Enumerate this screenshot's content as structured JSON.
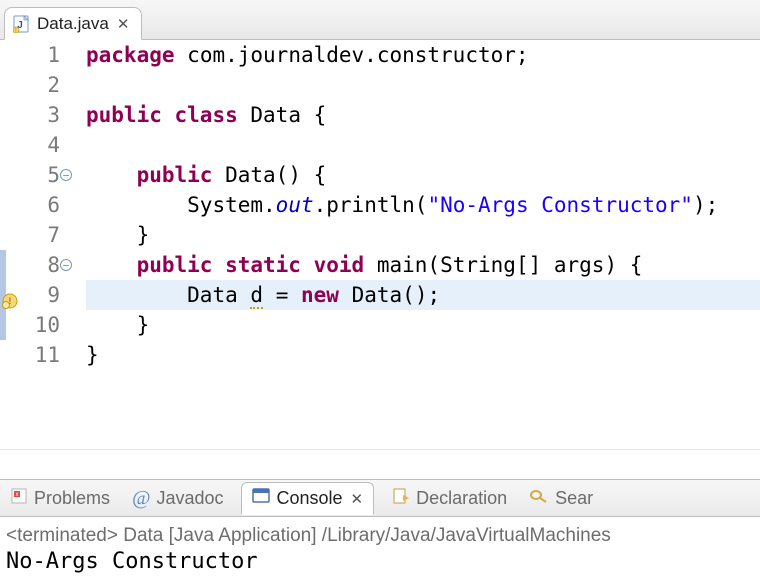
{
  "editor": {
    "tab": {
      "filename": "Data.java",
      "close_glyph": "✕"
    },
    "lines": [
      {
        "n": 1,
        "tokens": [
          [
            "kw",
            "package"
          ],
          [
            "sp",
            " "
          ],
          [
            "pkg",
            "com.journaldev.constructor"
          ],
          [
            "p",
            ";"
          ]
        ]
      },
      {
        "n": 2,
        "tokens": []
      },
      {
        "n": 3,
        "tokens": [
          [
            "kw",
            "public"
          ],
          [
            "sp",
            " "
          ],
          [
            "kw",
            "class"
          ],
          [
            "sp",
            " "
          ],
          [
            "typ",
            "Data"
          ],
          [
            "sp",
            " "
          ],
          [
            "p",
            "{"
          ]
        ]
      },
      {
        "n": 4,
        "tokens": []
      },
      {
        "n": 5,
        "fold": true,
        "tokens": [
          [
            "sp",
            "    "
          ],
          [
            "kw",
            "public"
          ],
          [
            "sp",
            " "
          ],
          [
            "typ",
            "Data"
          ],
          [
            "p",
            "() {"
          ]
        ]
      },
      {
        "n": 6,
        "tokens": [
          [
            "sp",
            "        "
          ],
          [
            "typ",
            "System"
          ],
          [
            "p",
            "."
          ],
          [
            "fld",
            "out"
          ],
          [
            "p",
            "."
          ],
          [
            "mth",
            "println"
          ],
          [
            "p",
            "("
          ],
          [
            "str",
            "\"No-Args Constructor\""
          ],
          [
            "p",
            ");"
          ]
        ]
      },
      {
        "n": 7,
        "tokens": [
          [
            "sp",
            "    "
          ],
          [
            "p",
            "}"
          ]
        ]
      },
      {
        "n": 8,
        "fold": true,
        "changebar": true,
        "tokens": [
          [
            "sp",
            "    "
          ],
          [
            "kw",
            "public"
          ],
          [
            "sp",
            " "
          ],
          [
            "kw",
            "static"
          ],
          [
            "sp",
            " "
          ],
          [
            "kw",
            "void"
          ],
          [
            "sp",
            " "
          ],
          [
            "mth",
            "main"
          ],
          [
            "p",
            "("
          ],
          [
            "typ",
            "String"
          ],
          [
            "p",
            "[] "
          ],
          [
            "typ",
            "args"
          ],
          [
            "p",
            ") {"
          ]
        ]
      },
      {
        "n": 9,
        "highlight": true,
        "changebar": true,
        "warn": true,
        "tokens": [
          [
            "sp",
            "        "
          ],
          [
            "typ",
            "Data"
          ],
          [
            "sp",
            " "
          ],
          [
            "warnvar",
            "d"
          ],
          [
            "sp",
            " "
          ],
          [
            "p",
            "= "
          ],
          [
            "kw",
            "new"
          ],
          [
            "sp",
            " "
          ],
          [
            "typ",
            "Data"
          ],
          [
            "p",
            "();"
          ]
        ]
      },
      {
        "n": 10,
        "changebar": true,
        "tokens": [
          [
            "sp",
            "    "
          ],
          [
            "p",
            "}"
          ]
        ]
      },
      {
        "n": 11,
        "tokens": [
          [
            "p",
            "}"
          ]
        ]
      }
    ]
  },
  "bottom_tabs": {
    "problems": "Problems",
    "javadoc": "Javadoc",
    "console": "Console",
    "declaration": "Declaration",
    "search": "Sear"
  },
  "console": {
    "status": "<terminated> Data [Java Application] /Library/Java/JavaVirtualMachines",
    "output": "No-Args Constructor"
  }
}
